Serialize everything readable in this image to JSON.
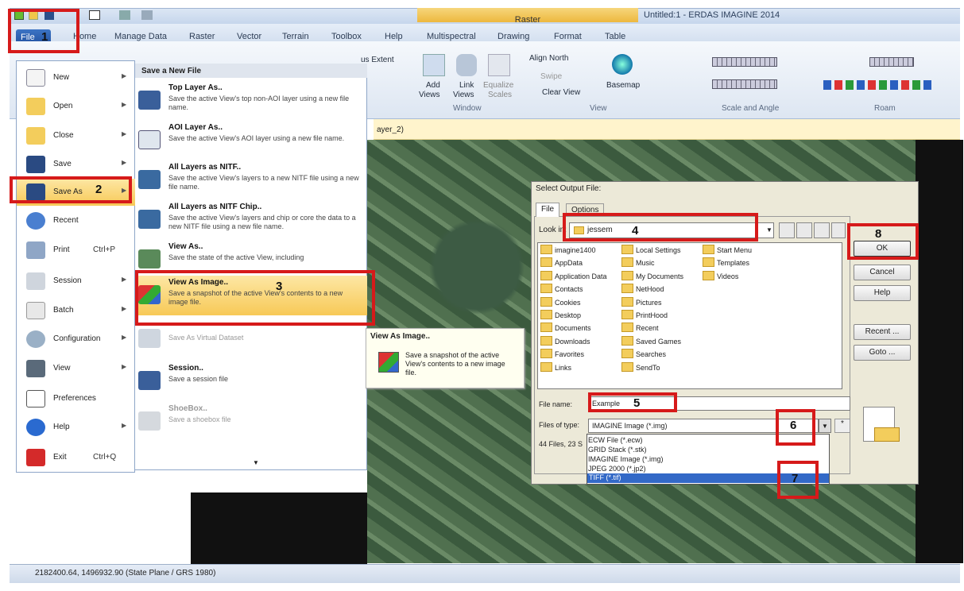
{
  "window": {
    "title": "Untitled:1 - ERDAS IMAGINE 2014",
    "context_tab": "Raster"
  },
  "tabs": [
    "File",
    "Home",
    "Manage Data",
    "Raster",
    "Vector",
    "Terrain",
    "Toolbox",
    "Help",
    "Multispectral",
    "Drawing",
    "Format",
    "Table"
  ],
  "ribbon": {
    "extent": "us Extent",
    "add": "Add",
    "views": "Views",
    "link": "Link",
    "link_views": "Views",
    "equalize": "Equalize",
    "scales": "Scales",
    "window_group": "Window",
    "align_north": "Align North",
    "swipe": "Swipe",
    "clear_view": "Clear View",
    "basemap": "Basemap",
    "view_group": "View",
    "scale_group": "Scale and Angle",
    "roam_group": "Roam"
  },
  "viewer": {
    "layer_tab": "ayer_2)"
  },
  "file_menu": {
    "items": [
      {
        "label": "New",
        "arrow": true
      },
      {
        "label": "Open",
        "arrow": true
      },
      {
        "label": "Close",
        "arrow": true
      },
      {
        "label": "Save",
        "arrow": true
      },
      {
        "label": "Save As",
        "arrow": true
      },
      {
        "label": "Recent",
        "arrow": false
      },
      {
        "label": "Print",
        "shortcut": "Ctrl+P"
      },
      {
        "label": "Session",
        "arrow": true
      },
      {
        "label": "Batch",
        "arrow": true
      },
      {
        "label": "Configuration",
        "arrow": true
      },
      {
        "label": "View",
        "arrow": true
      },
      {
        "label": "Preferences",
        "arrow": false
      },
      {
        "label": "Help",
        "arrow": true
      },
      {
        "label": "Exit",
        "shortcut": "Ctrl+Q"
      }
    ]
  },
  "save_as_menu": {
    "header": "Save a New File",
    "items": [
      {
        "title": "Top Layer As..",
        "desc": "Save the active View's top non-AOI layer using a new file name."
      },
      {
        "title": "AOI Layer As..",
        "desc": "Save the active View's AOI layer using a new file name."
      },
      {
        "title": "All Layers as NITF..",
        "desc": "Save the active View's layers to a new NITF file using a new file name."
      },
      {
        "title": "All Layers as NITF Chip..",
        "desc": "Save the active View's layers and chip or core the data to a new NITF file using a new file name."
      },
      {
        "title": "View As..",
        "desc": "Save the state of the active View, including"
      },
      {
        "title": "View As Image..",
        "desc": "Save a snapshot of the active View's contents to a new image file."
      },
      {
        "title": "",
        "desc": "Save As Virtual Dataset"
      },
      {
        "title": "Session..",
        "desc": "Save a session file"
      },
      {
        "title": "ShoeBox..",
        "desc": "Save a shoebox file"
      }
    ]
  },
  "tooltip": {
    "title": "View As Image..",
    "desc": "Save a snapshot of the active View's contents to a new image file."
  },
  "dialog": {
    "title": "Select Output File:",
    "tab_file": "File",
    "tab_options": "Options",
    "look_in_label": "Look in:",
    "look_in": "jessem",
    "files_col1": [
      "imagine1400",
      "AppData",
      "Application Data",
      "Contacts",
      "Cookies",
      "Desktop",
      "Documents",
      "Downloads",
      "Favorites",
      "Links"
    ],
    "files_col2": [
      "Local Settings",
      "Music",
      "My Documents",
      "NetHood",
      "Pictures",
      "PrintHood",
      "Recent",
      "Saved Games",
      "Searches",
      "SendTo"
    ],
    "files_col3": [
      "Start Menu",
      "Templates",
      "Videos"
    ],
    "file_name_label": "File name:",
    "file_name": "Example",
    "files_of_type_label": "Files of type:",
    "file_type": "IMAGINE Image (*.img)",
    "count": "44 Files, 23 S",
    "type_options": [
      "ECW File (*.ecw)",
      "GRID Stack (*.stk)",
      "IMAGINE Image (*.img)",
      "JPEG 2000 (*.jp2)",
      "TIFF (*.tif)"
    ],
    "buttons": {
      "ok": "OK",
      "cancel": "Cancel",
      "help": "Help",
      "recent": "Recent ...",
      "goto": "Goto ..."
    }
  },
  "status": {
    "coords": "2182400.64, 1496932.90  (State Plane / GRS 1980)"
  },
  "steps": [
    "1",
    "2",
    "3",
    "4",
    "5",
    "6",
    "7",
    "8"
  ]
}
